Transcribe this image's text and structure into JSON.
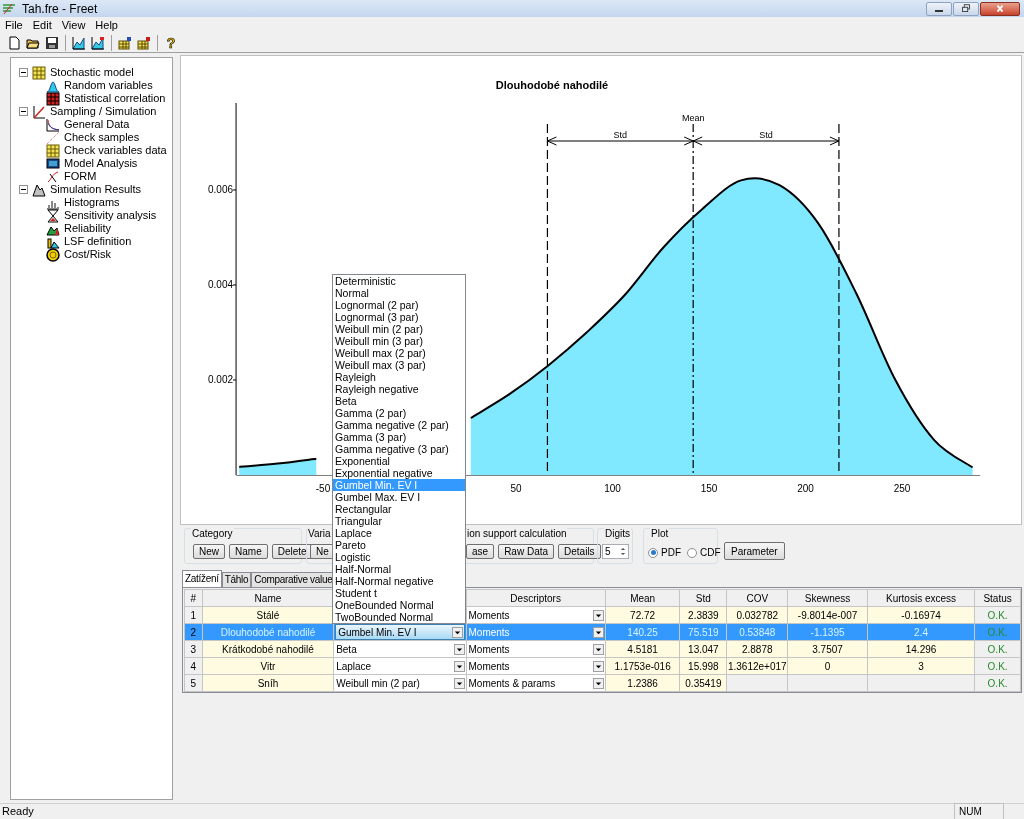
{
  "window": {
    "title": "Tah.fre - Freet"
  },
  "menu": [
    "File",
    "Edit",
    "View",
    "Help"
  ],
  "toolbar": {
    "help_glyph": "?"
  },
  "tree": [
    {
      "label": "Stochastic model",
      "kind": "grid",
      "expanded": true,
      "children": [
        {
          "label": "Random variables",
          "kind": "bell"
        },
        {
          "label": "Statistical correlation",
          "kind": "matrix"
        }
      ]
    },
    {
      "label": "Sampling / Simulation",
      "kind": "sampling",
      "expanded": true,
      "children": [
        {
          "label": "General Data",
          "kind": "general"
        },
        {
          "label": "Check samples",
          "kind": "check"
        },
        {
          "label": "Check variables data",
          "kind": "grid"
        },
        {
          "label": "Model Analysis",
          "kind": "model"
        },
        {
          "label": "FORM",
          "kind": "form"
        }
      ]
    },
    {
      "label": "Simulation Results",
      "kind": "results",
      "expanded": true,
      "children": [
        {
          "label": "Histograms",
          "kind": "histogram"
        },
        {
          "label": "Sensitivity analysis",
          "kind": "sensitivity"
        },
        {
          "label": "Reliability",
          "kind": "reliability"
        },
        {
          "label": "LSF definition",
          "kind": "lsf"
        },
        {
          "label": "Cost/Risk",
          "kind": "cost"
        }
      ]
    }
  ],
  "chart": {
    "chart_data": {
      "type": "area",
      "title": "Dlouhodobé nahodilé",
      "x": [
        -95,
        -75,
        -55,
        -35,
        -15,
        5,
        25,
        45,
        65,
        85,
        105,
        125,
        145,
        165,
        185,
        205,
        225,
        245,
        265,
        285
      ],
      "series": [
        {
          "color": "#80e8ff",
          "values": [
            0.00017,
            0.00024,
            0.00034,
            null,
            null,
            null,
            0.0012,
            0.0017,
            0.0023,
            0.003,
            0.0038,
            0.0048,
            0.0056,
            0.0062,
            0.0061,
            0.0053,
            0.0038,
            0.002,
            0.00074,
            0.00016
          ]
        }
      ],
      "xlim": [
        -96.6,
        289
      ],
      "ylim": [
        0,
        0.00783
      ],
      "xticks": [
        -50,
        50,
        100,
        150,
        200,
        250
      ],
      "yticks": [
        0.002,
        0.004,
        0.006
      ],
      "ref_lines": [
        {
          "axis": "x",
          "value": 64.73
        },
        {
          "axis": "x",
          "value": 140.25
        },
        {
          "axis": "x",
          "value": 215.77
        }
      ],
      "annotations": [
        "Mean",
        "Std",
        "Std"
      ]
    }
  },
  "controls": {
    "category": {
      "label": "Category",
      "buttons": [
        "New",
        "Name",
        "Delete"
      ]
    },
    "variables": {
      "label": "Varia",
      "buttons": [
        "Ne"
      ]
    },
    "calculation": {
      "label": "ion support calculation",
      "buttons": [
        "ase",
        "Raw Data",
        "Details"
      ]
    },
    "digits": {
      "label": "Digits",
      "value": "5"
    },
    "plot": {
      "label": "Plot",
      "options": [
        {
          "label": "PDF",
          "selected": true
        },
        {
          "label": "CDF",
          "selected": false
        }
      ]
    },
    "parameter_button": "Parameter"
  },
  "tabs": [
    {
      "label": "Zatížení",
      "selected": true
    },
    {
      "label": "Táhlo",
      "selected": false
    },
    {
      "label": "Comparative value",
      "selected": false
    }
  ],
  "table": {
    "columns": [
      "#",
      "Name",
      "Descriptors",
      "Mean",
      "Std",
      "COV",
      "Skewness",
      "Kurtosis excess",
      "Status"
    ],
    "rows": [
      {
        "number": "1",
        "name": "Stálé",
        "descriptors": "Moments",
        "mean": "72.72",
        "std": "2.3839",
        "cov": "0.032782",
        "skewness": "-9.8014e-007",
        "kurtosis": "-0.16974",
        "status": "O.K.",
        "selected": false
      },
      {
        "number": "2",
        "name": "Dlouhodobé nahodilé",
        "distribution": "Gumbel Min. EV I",
        "descriptors": "Moments",
        "mean": "140.25",
        "std": "75.519",
        "cov": "0.53848",
        "skewness": "-1.1395",
        "kurtosis": "2.4",
        "status": "O.K.",
        "selected": true
      },
      {
        "number": "3",
        "name": "Krátkodobé nahodilé",
        "distribution": "Beta",
        "descriptors": "Moments",
        "mean": "4.5181",
        "std": "13.047",
        "cov": "2.8878",
        "skewness": "3.7507",
        "kurtosis": "14.296",
        "status": "O.K.",
        "selected": false
      },
      {
        "number": "4",
        "name": "Vitr",
        "distribution": "Laplace",
        "descriptors": "Moments",
        "mean": "1.1753e-016",
        "std": "15.998",
        "cov": "1.3612e+017",
        "skewness": "0",
        "kurtosis": "3",
        "status": "O.K.",
        "selected": false
      },
      {
        "number": "5",
        "name": "Sníh",
        "distribution": "Weibull min (2 par)",
        "descriptors": "Moments & params",
        "mean": "1.2386",
        "std": "0.35419",
        "status": "O.K.",
        "selected": false
      }
    ]
  },
  "distribution_dropdown": {
    "options": [
      {
        "label": "Deterministic",
        "selected": false
      },
      {
        "label": "Normal",
        "selected": false
      },
      {
        "label": "Lognormal (2 par)",
        "selected": false
      },
      {
        "label": "Lognormal (3 par)",
        "selected": false
      },
      {
        "label": "Weibull min (2 par)",
        "selected": false
      },
      {
        "label": "Weibull min (3 par)",
        "selected": false
      },
      {
        "label": "Weibull max (2 par)",
        "selected": false
      },
      {
        "label": "Weibull max (3 par)",
        "selected": false
      },
      {
        "label": "Rayleigh",
        "selected": false
      },
      {
        "label": "Rayleigh negative",
        "selected": false
      },
      {
        "label": "Beta",
        "selected": false
      },
      {
        "label": "Gamma (2 par)",
        "selected": false
      },
      {
        "label": "Gamma negative (2 par)",
        "selected": false
      },
      {
        "label": "Gamma (3 par)",
        "selected": false
      },
      {
        "label": "Gamma negative (3 par)",
        "selected": false
      },
      {
        "label": "Exponential",
        "selected": false
      },
      {
        "label": "Exponential negative",
        "selected": false
      },
      {
        "label": "Gumbel Min. EV I",
        "selected": true
      },
      {
        "label": "Gumbel Max. EV I",
        "selected": false
      },
      {
        "label": "Rectangular",
        "selected": false
      },
      {
        "label": "Triangular",
        "selected": false
      },
      {
        "label": "Laplace",
        "selected": false
      },
      {
        "label": "Pareto",
        "selected": false
      },
      {
        "label": "Logistic",
        "selected": false
      },
      {
        "label": "Half-Normal",
        "selected": false
      },
      {
        "label": "Half-Normal negative",
        "selected": false
      },
      {
        "label": "Student t",
        "selected": false
      },
      {
        "label": "OneBounded Normal",
        "selected": false
      },
      {
        "label": "TwoBounded Normal",
        "selected": false
      }
    ]
  },
  "status_bar": {
    "text": "Ready",
    "indicator": "NUM"
  }
}
